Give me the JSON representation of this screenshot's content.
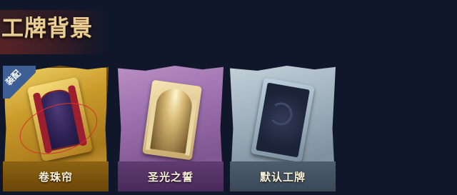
{
  "header": {
    "title": "工牌背景"
  },
  "cards": [
    {
      "label": "卷珠帘",
      "equipped_badge": "装配",
      "selected": true
    },
    {
      "label": "圣光之誓",
      "selected": false
    },
    {
      "label": "默认工牌",
      "selected": false
    }
  ],
  "colors": {
    "title": "#e9cf96",
    "card_1_frame": "#c99a2a",
    "card_2_frame": "#9a6eab",
    "card_3_frame": "#9fb0bd",
    "badge": "#3d5f93",
    "highlight": "#d8302a"
  }
}
